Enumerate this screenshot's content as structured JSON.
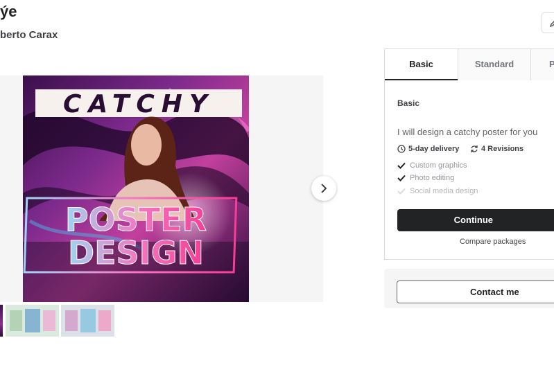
{
  "header": {
    "title_fragment": "ýe",
    "seller_name_fragment": "berto Carax"
  },
  "gallery": {
    "poster": {
      "headline": "CATCHY",
      "main_text_line1": "POSTER",
      "main_text_line2": "DESIGN"
    }
  },
  "package": {
    "tabs": [
      "Basic",
      "Standard",
      "P"
    ],
    "active_tab": "Basic",
    "name": "Basic",
    "description": "I will design a catchy poster for you",
    "delivery": "5-day delivery",
    "revisions": "4 Revisions",
    "features": [
      {
        "label": "Custom graphics",
        "included": true
      },
      {
        "label": "Photo editing",
        "included": true
      },
      {
        "label": "Social media design",
        "included": false
      }
    ],
    "continue_label": "Continue",
    "compare_label": "Compare packages"
  },
  "contact": {
    "label": "Contact me"
  },
  "colors": {
    "primary_button": "#222325",
    "text": "#404145",
    "muted": "#95979d",
    "border": "#dadbdd",
    "poster_pink": "#e6409a",
    "poster_purple": "#6b2a8c"
  },
  "icons": {
    "edit": "pencil-icon",
    "next": "chevron-right-icon",
    "delivery": "clock-icon",
    "revisions": "refresh-icon",
    "feature_check": "check-icon"
  }
}
